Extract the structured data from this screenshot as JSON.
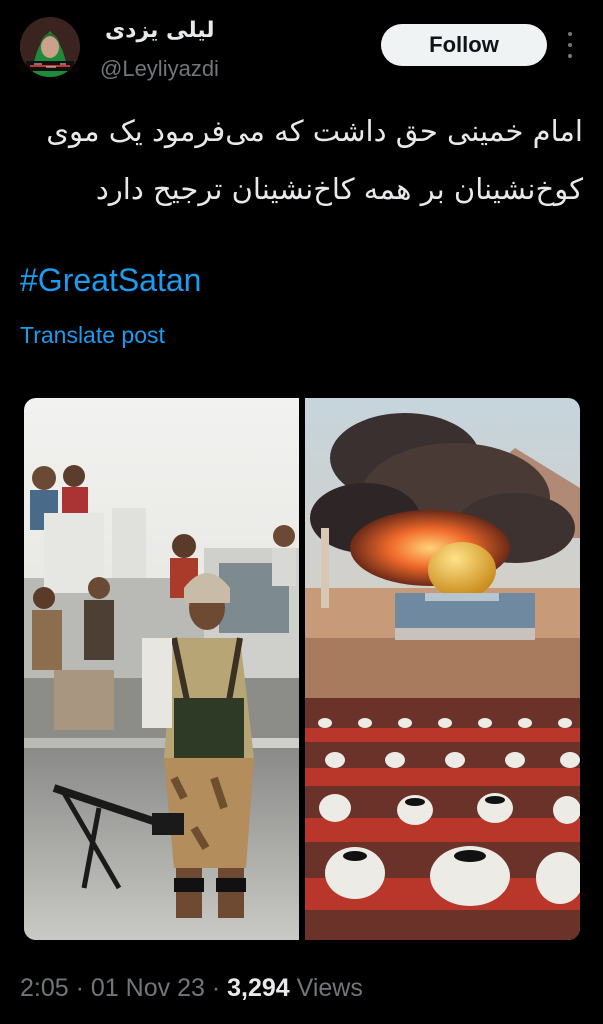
{
  "author": {
    "display_name": "لیلی یزدی",
    "handle": "@Leyliyazdi",
    "follow_label": "Follow"
  },
  "post": {
    "text": "امام خمینی حق داشت که می‌فرمود یک موی کوخ‌نشینان بر همه کاخ‌نشینان ترجیح دارد",
    "hashtag": "#GreatSatan",
    "translate_label": "Translate post"
  },
  "meta": {
    "time": "2:05",
    "separator": "·",
    "date": "01 Nov 23",
    "views_count": "3,294",
    "views_label": "Views"
  },
  "colors": {
    "background": "#000000",
    "text": "#e7e9ea",
    "muted": "#71767b",
    "link": "#1d9bf0",
    "button_bg": "#eff3f4"
  },
  "icons": {
    "more": "more-icon",
    "avatar": "avatar"
  }
}
